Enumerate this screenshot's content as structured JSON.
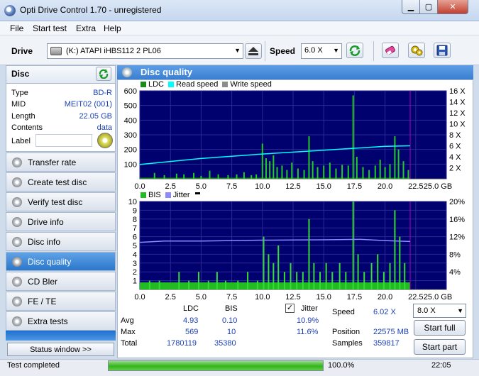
{
  "window": {
    "title": "Opti Drive Control 1.70 - unregistered",
    "min_glyph": "▁",
    "max_glyph": "▢",
    "close_glyph": "✕"
  },
  "menu": [
    {
      "label": "File"
    },
    {
      "label": "Start test"
    },
    {
      "label": "Extra"
    },
    {
      "label": "Help"
    }
  ],
  "toolbar": {
    "drive_label": "Drive",
    "drive_value": "(K:)   ATAPI iHBS112   2 PL06",
    "speed_label": "Speed",
    "speed_value": "6.0 X",
    "arrow": "▼"
  },
  "icons": {
    "refresh": "refresh-icon",
    "eject": "eject-icon",
    "erase": "erase-icon",
    "settings": "settings-icon",
    "save": "save-icon"
  },
  "disc": {
    "title": "Disc",
    "rows": [
      {
        "key": "Type",
        "value": "BD-R"
      },
      {
        "key": "MID",
        "value": "MEIT02 (001)"
      },
      {
        "key": "Length",
        "value": "22.05 GB"
      },
      {
        "key": "Contents",
        "value": "data"
      }
    ],
    "label_key": "Label"
  },
  "nav": [
    {
      "label": "Transfer rate",
      "active": false
    },
    {
      "label": "Create test disc",
      "active": false
    },
    {
      "label": "Verify test disc",
      "active": false
    },
    {
      "label": "Drive info",
      "active": false
    },
    {
      "label": "Disc info",
      "active": false
    },
    {
      "label": "Disc quality",
      "active": true
    },
    {
      "label": "CD Bler",
      "active": false
    },
    {
      "label": "FE / TE",
      "active": false
    },
    {
      "label": "Extra tests",
      "active": false
    }
  ],
  "status_window_label": "Status window >>",
  "main_title": "Disc quality",
  "colors": {
    "ldc": "#1a8a1a",
    "bis": "#22bb22",
    "read_speed": "#00ffff",
    "write_speed": "#8c8c8c",
    "jitter": "#8b8bff",
    "chart_bg": "#00006e",
    "grid": "#2a2a90",
    "marker": "#b000b0"
  },
  "chart_data": [
    {
      "type": "bar",
      "legend": [
        "LDC",
        "Read speed",
        "Write speed"
      ],
      "y_ticks": [
        "600",
        "500",
        "400",
        "300",
        "200",
        "100"
      ],
      "y_right_ticks": [
        "16 X",
        "14 X",
        "12 X",
        "10 X",
        "8 X",
        "6 X",
        "4 X",
        "2 X"
      ],
      "x_ticks": [
        "0.0",
        "2.5",
        "5.0",
        "7.5",
        "10.0",
        "12.5",
        "15.0",
        "17.5",
        "20.0",
        "22.5",
        "25.0 GB"
      ],
      "ylim": [
        0,
        600
      ],
      "y2lim": [
        0,
        16
      ],
      "xlim": [
        0,
        25
      ],
      "x_end": 22.05,
      "read_speed": {
        "x": [
          0.0,
          5.0,
          10.0,
          15.0,
          20.0,
          22.05
        ],
        "y": [
          2.6,
          3.7,
          4.5,
          5.2,
          5.9,
          6.0
        ]
      },
      "spikes": [
        {
          "x": 1.2,
          "y": 40
        },
        {
          "x": 2.0,
          "y": 25
        },
        {
          "x": 3.0,
          "y": 35
        },
        {
          "x": 3.6,
          "y": 30
        },
        {
          "x": 4.4,
          "y": 40
        },
        {
          "x": 5.0,
          "y": 20
        },
        {
          "x": 5.7,
          "y": 55
        },
        {
          "x": 6.4,
          "y": 30
        },
        {
          "x": 7.2,
          "y": 25
        },
        {
          "x": 7.9,
          "y": 30
        },
        {
          "x": 8.5,
          "y": 45
        },
        {
          "x": 9.1,
          "y": 25
        },
        {
          "x": 9.5,
          "y": 30
        },
        {
          "x": 10.0,
          "y": 240
        },
        {
          "x": 10.3,
          "y": 140
        },
        {
          "x": 10.6,
          "y": 120
        },
        {
          "x": 10.9,
          "y": 160
        },
        {
          "x": 11.2,
          "y": 80
        },
        {
          "x": 11.6,
          "y": 90
        },
        {
          "x": 12.0,
          "y": 60
        },
        {
          "x": 12.4,
          "y": 110
        },
        {
          "x": 12.9,
          "y": 70
        },
        {
          "x": 13.4,
          "y": 60
        },
        {
          "x": 13.8,
          "y": 290
        },
        {
          "x": 14.1,
          "y": 120
        },
        {
          "x": 14.5,
          "y": 80
        },
        {
          "x": 15.0,
          "y": 90
        },
        {
          "x": 15.5,
          "y": 110
        },
        {
          "x": 16.0,
          "y": 70
        },
        {
          "x": 16.5,
          "y": 95
        },
        {
          "x": 17.0,
          "y": 90
        },
        {
          "x": 17.4,
          "y": 569
        },
        {
          "x": 17.7,
          "y": 150
        },
        {
          "x": 18.2,
          "y": 80
        },
        {
          "x": 18.7,
          "y": 60
        },
        {
          "x": 19.2,
          "y": 90
        },
        {
          "x": 19.6,
          "y": 130
        },
        {
          "x": 20.0,
          "y": 80
        },
        {
          "x": 20.4,
          "y": 100
        },
        {
          "x": 20.8,
          "y": 290
        },
        {
          "x": 21.1,
          "y": 200
        },
        {
          "x": 21.5,
          "y": 120
        },
        {
          "x": 21.9,
          "y": 60
        }
      ]
    },
    {
      "type": "bar",
      "legend": [
        "BIS",
        "Jitter"
      ],
      "y_ticks": [
        "10",
        "9",
        "8",
        "7",
        "6",
        "5",
        "4",
        "3",
        "2",
        "1"
      ],
      "y_right_ticks": [
        "20%",
        "16%",
        "12%",
        "8%",
        "4%"
      ],
      "x_ticks": [
        "0.0",
        "2.5",
        "5.0",
        "7.5",
        "10.0",
        "12.5",
        "15.0",
        "17.5",
        "20.0",
        "22.5",
        "25.0 GB"
      ],
      "ylim": [
        0,
        10
      ],
      "y2lim": [
        0,
        20
      ],
      "xlim": [
        0,
        25
      ],
      "x_end": 22.05,
      "jitter": {
        "x": [
          0.0,
          2.0,
          5.0,
          10.0,
          15.0,
          18.0,
          20.0,
          22.05
        ],
        "y": [
          10.7,
          11.0,
          11.0,
          11.2,
          11.3,
          11.4,
          11.1,
          10.9
        ]
      },
      "spikes": [
        {
          "x": 0.8,
          "y": 1
        },
        {
          "x": 1.6,
          "y": 1
        },
        {
          "x": 3.2,
          "y": 2
        },
        {
          "x": 4.0,
          "y": 1
        },
        {
          "x": 4.8,
          "y": 2
        },
        {
          "x": 5.6,
          "y": 1
        },
        {
          "x": 6.3,
          "y": 2
        },
        {
          "x": 7.0,
          "y": 1
        },
        {
          "x": 8.0,
          "y": 1
        },
        {
          "x": 8.8,
          "y": 2
        },
        {
          "x": 9.6,
          "y": 1
        },
        {
          "x": 10.1,
          "y": 6
        },
        {
          "x": 10.5,
          "y": 4
        },
        {
          "x": 10.9,
          "y": 3
        },
        {
          "x": 11.3,
          "y": 5
        },
        {
          "x": 11.8,
          "y": 2
        },
        {
          "x": 12.3,
          "y": 3
        },
        {
          "x": 12.8,
          "y": 2
        },
        {
          "x": 13.3,
          "y": 2
        },
        {
          "x": 13.8,
          "y": 8
        },
        {
          "x": 14.2,
          "y": 3
        },
        {
          "x": 14.7,
          "y": 2
        },
        {
          "x": 15.2,
          "y": 3
        },
        {
          "x": 15.7,
          "y": 2
        },
        {
          "x": 16.3,
          "y": 3
        },
        {
          "x": 16.8,
          "y": 2
        },
        {
          "x": 17.4,
          "y": 10
        },
        {
          "x": 17.8,
          "y": 4
        },
        {
          "x": 18.3,
          "y": 2
        },
        {
          "x": 18.9,
          "y": 3
        },
        {
          "x": 19.4,
          "y": 4
        },
        {
          "x": 19.9,
          "y": 2
        },
        {
          "x": 20.4,
          "y": 3
        },
        {
          "x": 20.8,
          "y": 9
        },
        {
          "x": 21.2,
          "y": 6
        },
        {
          "x": 21.6,
          "y": 3
        }
      ]
    }
  ],
  "stats": {
    "headers": {
      "ldc": "LDC",
      "bis": "BIS",
      "jitter": "Jitter"
    },
    "jitter_checked": "✓",
    "rows": [
      {
        "label": "Avg",
        "ldc": "4.93",
        "bis": "0.10",
        "jitter": "10.9%"
      },
      {
        "label": "Max",
        "ldc": "569",
        "bis": "10",
        "jitter": "11.6%"
      },
      {
        "label": "Total",
        "ldc": "1780119",
        "bis": "35380"
      }
    ],
    "speed_label": "Speed",
    "speed_value": "6.02 X",
    "position_label": "Position",
    "position_value": "22575 MB",
    "samples_label": "Samples",
    "samples_value": "359817",
    "speed_select": "8.0 X",
    "start_full": "Start full",
    "start_part": "Start part"
  },
  "status": {
    "text": "Test completed",
    "progress_text": "100.0%",
    "progress_fraction": 1.0,
    "time": "22:05"
  }
}
